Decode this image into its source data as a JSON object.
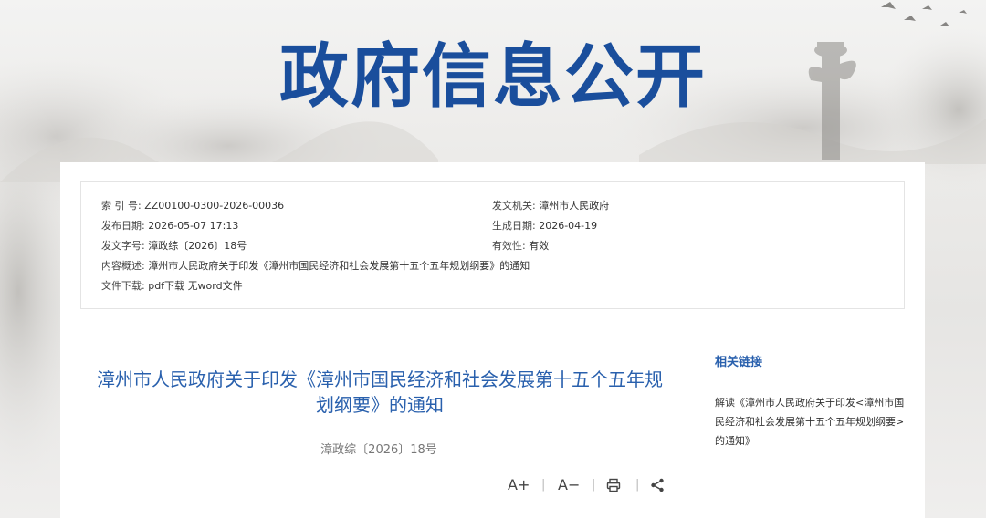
{
  "banner": {
    "title": "政府信息公开"
  },
  "meta": {
    "index_label": "索 引 号:",
    "index_value": "ZZ00100-0300-2026-00036",
    "issuer_label": "发文机关:",
    "issuer_value": "漳州市人民政府",
    "publish_label": "发布日期:",
    "publish_value": "2026-05-07 17:13",
    "generate_label": "生成日期:",
    "generate_value": "2026-04-19",
    "docno_label": "发文字号:",
    "docno_value": "漳政综〔2026〕18号",
    "validity_label": "有效性:",
    "validity_value": "有效",
    "summary_label": "内容概述:",
    "summary_value": "漳州市人民政府关于印发《漳州市国民经济和社会发展第十五个五年规划纲要》的通知",
    "download_label": "文件下载:",
    "pdf_label": "pdf下载",
    "word_label": "无word文件"
  },
  "article": {
    "title": "漳州市人民政府关于印发《漳州市国民经济和社会发展第十五个五年规划纲要》的通知",
    "doc_number": "漳政综〔2026〕18号",
    "font_up": "A+",
    "font_down": "A−"
  },
  "sidebar": {
    "title": "相关链接",
    "link": "解读《漳州市人民政府关于印发<漳州市国民经济和社会发展第十五个五年规划纲要>的通知》"
  },
  "colors": {
    "primary_blue": "#1a4e9c",
    "link_blue": "#2960ad"
  }
}
